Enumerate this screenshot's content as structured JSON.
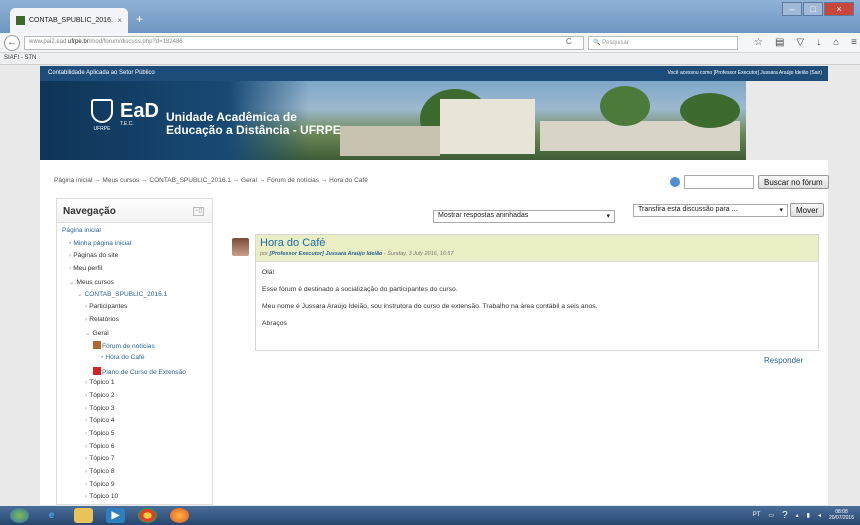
{
  "browser": {
    "tab_title": "CONTAB_SPUBLIC_2016.1: ...",
    "tab_close": "×",
    "new_tab": "+",
    "url_prefix": "www.pai2.ead.",
    "url_host": "ufrpe.br",
    "url_path": "/mod/forum/discuss.php?d=182486",
    "search_placeholder": "Pesquisar",
    "bookmark": "SIAFI - STN"
  },
  "site": {
    "name": "Contabilidade Aplicada ao Setor Público",
    "login_info": "Você acessou como [Professor Executor] Jussara Araújo Ideião (Sair)",
    "banner_title_line1": "Unidade Acadêmica de",
    "banner_title_line2": "Educação a Distância - UFRPE",
    "logo_ufrpe": "UFRPE",
    "logo_ead": "EaD",
    "logo_tec": "T.E.C."
  },
  "breadcrumb": "Página inicial → Meus cursos → CONTAB_SPUBLIC_2016.1 → Geral → Fórum de notícias → Hora do Café",
  "forum_search": {
    "button": "Buscar no fórum"
  },
  "navigation": {
    "title": "Navegação",
    "items": [
      {
        "label": "Página inicial",
        "prefix": ""
      },
      {
        "label": "Minha página inicial",
        "prefix": "•"
      },
      {
        "label": "Páginas do site",
        "prefix": "›"
      },
      {
        "label": "Meu perfil",
        "prefix": "›"
      },
      {
        "label": "Meus cursos",
        "prefix": "⌄"
      },
      {
        "label": "CONTAB_SPUBLIC_2016.1",
        "prefix": "⌄"
      },
      {
        "label": "Participantes",
        "prefix": "›"
      },
      {
        "label": "Relatórios",
        "prefix": "›"
      },
      {
        "label": "Geral",
        "prefix": "⌄"
      },
      {
        "label": "Fórum de notícias",
        "prefix": ""
      },
      {
        "label": "Hora do Café",
        "prefix": "•"
      },
      {
        "label": "Plano de Curso de Extensão",
        "prefix": ""
      },
      {
        "label": "Tópico 1",
        "prefix": "›"
      },
      {
        "label": "Tópico 2",
        "prefix": "›"
      },
      {
        "label": "Tópico 3",
        "prefix": "›"
      },
      {
        "label": "Tópico 4",
        "prefix": "›"
      },
      {
        "label": "Tópico 5",
        "prefix": "›"
      },
      {
        "label": "Tópico 6",
        "prefix": "›"
      },
      {
        "label": "Tópico 7",
        "prefix": "›"
      },
      {
        "label": "Tópico 8",
        "prefix": "›"
      },
      {
        "label": "Tópico 9",
        "prefix": "›"
      },
      {
        "label": "Tópico 10",
        "prefix": "›"
      }
    ]
  },
  "discussion": {
    "display_mode": "Mostrar respostas aninhadas",
    "move_select": "Transfira esta discussão para ...",
    "move_button": "Mover",
    "post_title": "Hora do Café",
    "post_by": "por",
    "post_author": "[Professor Executor] Jussara Araújo Ideião",
    "post_date": "- Sunday, 3 July 2016, 16:57",
    "body": [
      "Olá!",
      "Esse fórum é destinado a socialização do participantes do curso.",
      "Meu nome é Jussara Araújo Ideião, sou instrutora do curso de extensão. Trabalho na área contábil a seis anos.",
      "Abraços"
    ],
    "reply": "Responder"
  },
  "taskbar": {
    "lang": "PT",
    "time": "08:08",
    "date": "20/07/2016"
  }
}
